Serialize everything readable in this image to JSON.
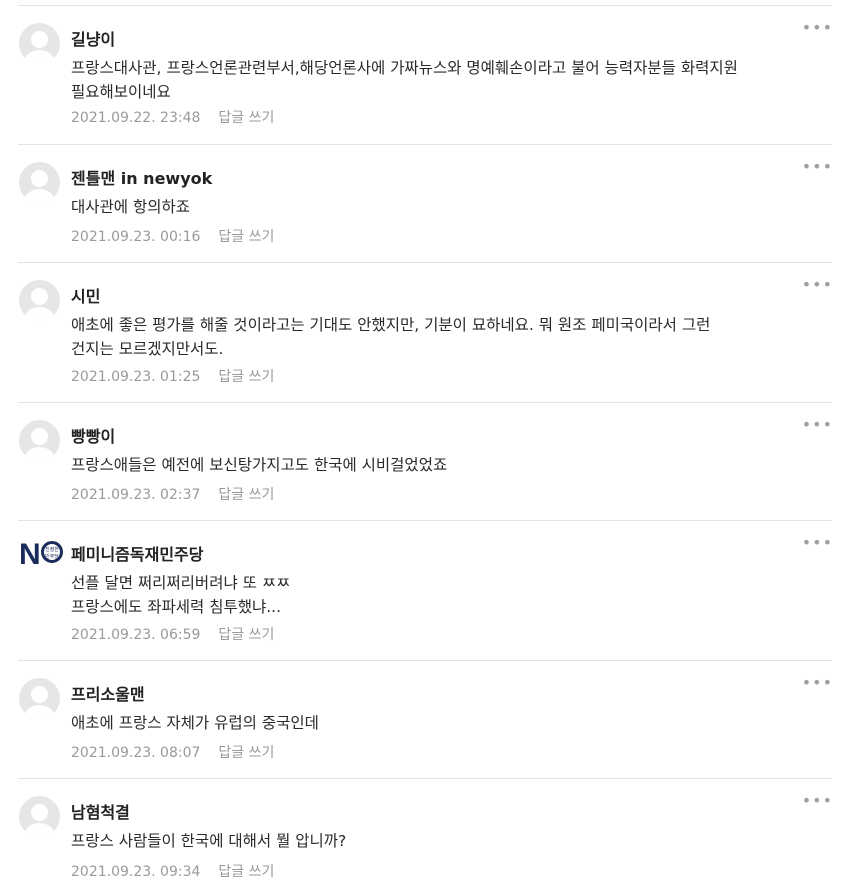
{
  "comments": [
    {
      "nickname": "길냥이",
      "content": "프랑스대사관, 프랑스언론관련부서,해당언론사에 가짜뉴스와 명예훼손이라고 불어 능력자분들 화력지원\n필요해보이네요",
      "date": "2021.09.22. 23:48",
      "reply_label": "답글 쓰기",
      "avatar": "default-avatar"
    },
    {
      "nickname": "젠틀맨 in newyok",
      "content": "대사관에 항의하죠",
      "date": "2021.09.23. 00:16",
      "reply_label": "답글 쓰기",
      "avatar": "default-avatar"
    },
    {
      "nickname": "시민",
      "content": "애초에 좋은 평가를 해줄 것이라고는 기대도 안했지만, 기분이 묘하네요. 뭐 원조 페미국이라서 그런\n건지는 모르겠지만서도.",
      "date": "2021.09.23. 01:25",
      "reply_label": "답글 쓰기",
      "avatar": "default-avatar"
    },
    {
      "nickname": "빵빵이",
      "content": "프랑스애들은 예전에 보신탕가지고도 한국에 시비걸었었죠",
      "date": "2021.09.23. 02:37",
      "reply_label": "답글 쓰기",
      "avatar": "default-avatar"
    },
    {
      "nickname": "페미니즘독재민주당",
      "content": "선플 달면 쩌리쩌리버려냐 또 ㅉㅉ\n프랑스에도 좌파세력 침투했냐...",
      "date": "2021.09.23. 06:59",
      "reply_label": "답글 쓰기",
      "avatar": "party-logo",
      "logo_text": "N",
      "logo_badge": "진정한 민주당"
    },
    {
      "nickname": "프리소울맨",
      "content": "애초에 프랑스 자체가 유럽의 중국인데",
      "date": "2021.09.23. 08:07",
      "reply_label": "답글 쓰기",
      "avatar": "default-avatar"
    },
    {
      "nickname": "남혐척결",
      "content": "프랑스 사람들이 한국에 대해서 뭘 압니까?",
      "date": "2021.09.23. 09:34",
      "reply_label": "답글 쓰기",
      "avatar": "default-avatar"
    }
  ],
  "more_icon": "more-options-icon",
  "colors": {
    "text": "#222222",
    "meta": "#9a9a9a",
    "divider": "#e3e3e3",
    "avatar_bg": "#e6e6e6",
    "logo": "#1a2c5b"
  }
}
